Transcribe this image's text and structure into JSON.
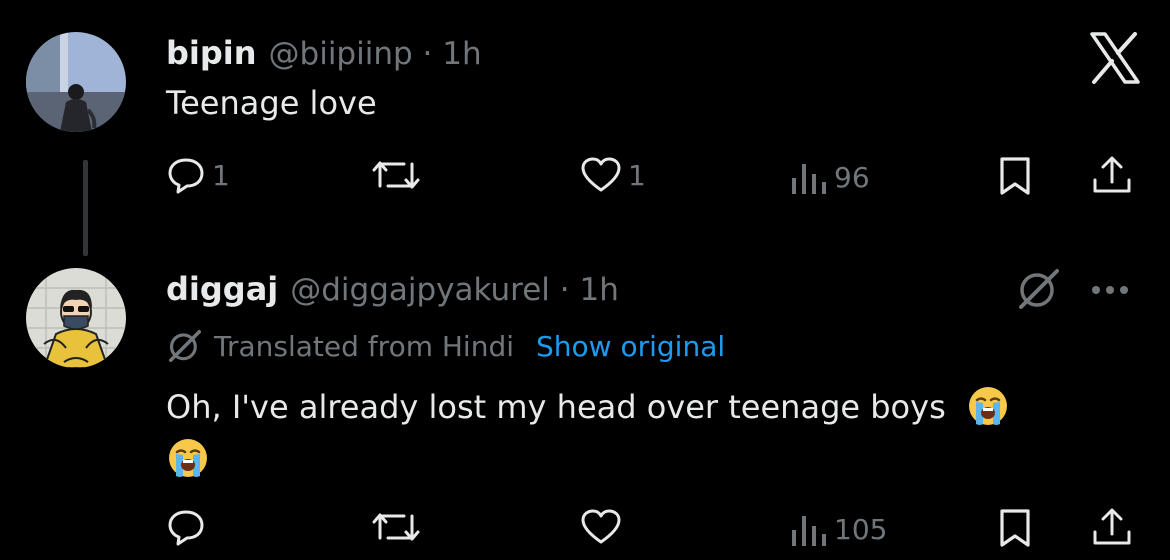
{
  "tweets": [
    {
      "name": "bipin",
      "handle": "@biipiinp · 1h",
      "text": "Teenage love",
      "replies": "1",
      "reposts": "",
      "likes": "1",
      "views": "96"
    },
    {
      "name": "diggaj",
      "handle": "@diggajpyakurel · 1h",
      "translated_label": "Translated from Hindi",
      "show_original": "Show original",
      "text": "Oh, I've already lost my head over teenage boys",
      "emoji": "loudly-crying-face",
      "replies": "",
      "reposts": "",
      "likes": "",
      "views": "105"
    }
  ],
  "colors": {
    "background": "#000000",
    "primary_text": "#e7e9ea",
    "secondary_text": "#71767b",
    "link": "#1d9bf0"
  }
}
